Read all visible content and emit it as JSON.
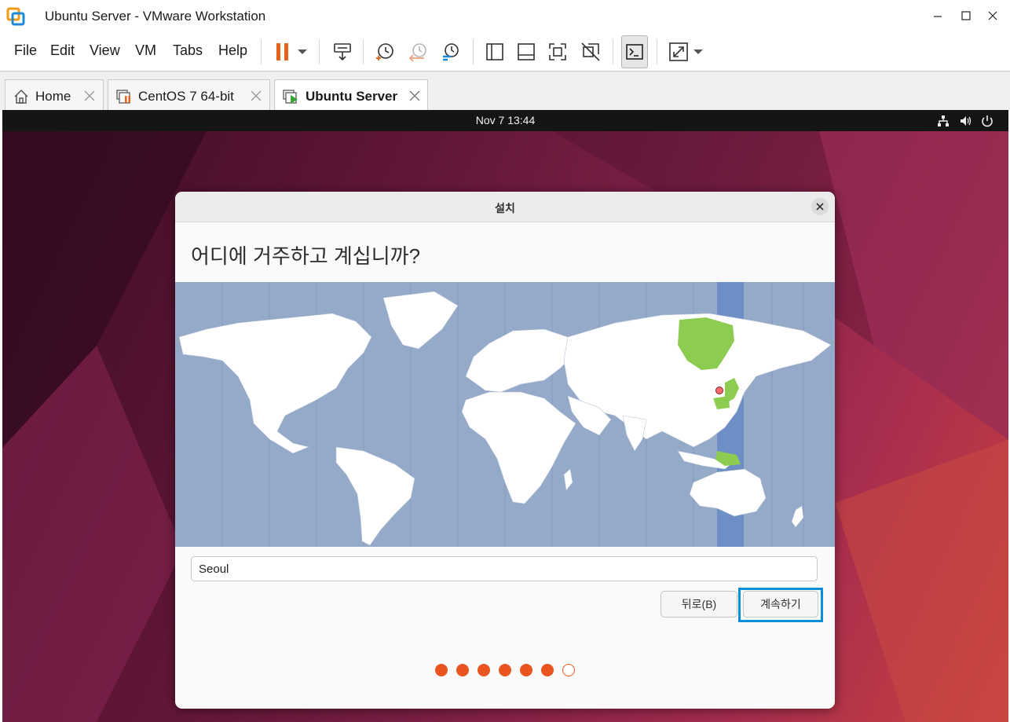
{
  "window": {
    "title": "Ubuntu Server - VMware Workstation"
  },
  "menu": [
    "File",
    "Edit",
    "View",
    "VM",
    "Tabs",
    "Help"
  ],
  "tabs": [
    {
      "label": "Home",
      "icon": "home-icon"
    },
    {
      "label": "CentOS 7 64-bit",
      "icon": "vm-paused-icon"
    },
    {
      "label": "Ubuntu Server",
      "icon": "vm-running-icon"
    }
  ],
  "guest": {
    "clock": "Nov 7  13:44"
  },
  "dialog": {
    "title": "설치",
    "question": "어디에 거주하고 계십니까?",
    "timezone_value": "Seoul",
    "back_label": "뒤로(B)",
    "continue_label": "계속하기",
    "steps_total": 7,
    "steps_completed": 6
  },
  "colors": {
    "accent": "#e95420",
    "focus": "#0b8fd8",
    "map_ocean": "#95a9c9",
    "map_selected_zone": "#6d8fc6",
    "map_highlight_land": "#8ccd51"
  }
}
